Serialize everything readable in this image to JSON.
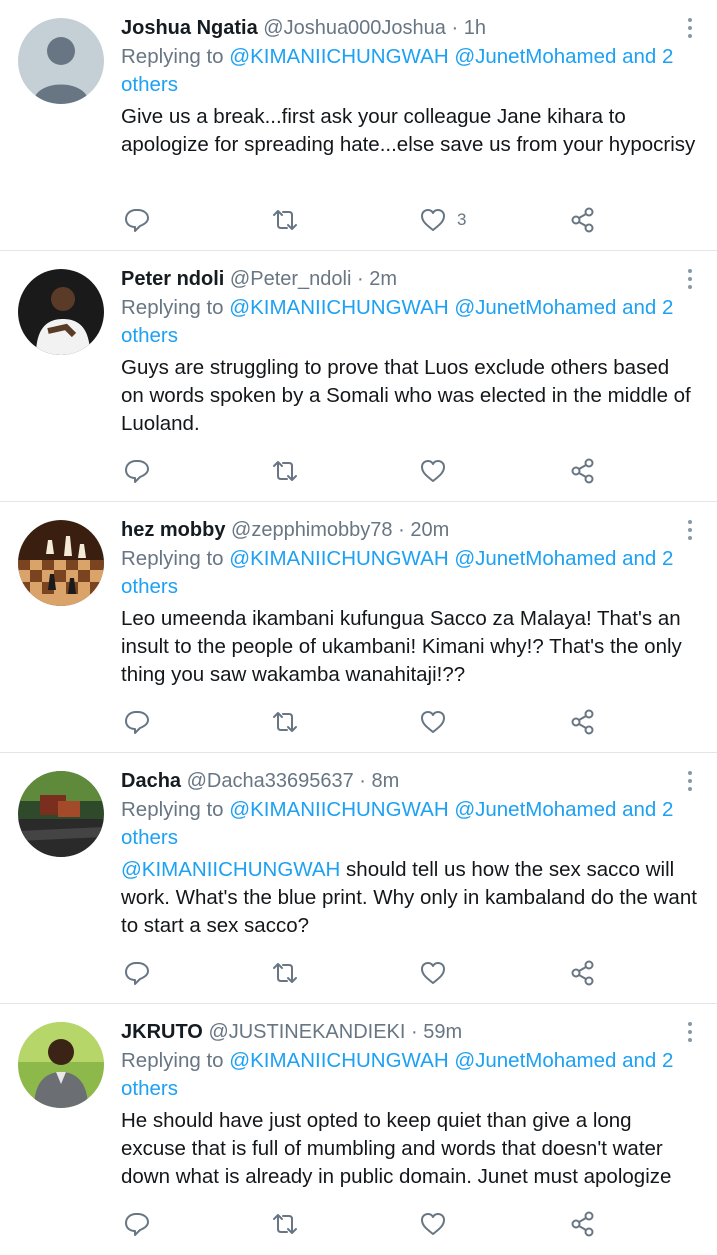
{
  "tweets": [
    {
      "name": "Joshua Ngatia",
      "handle": "@Joshua000Joshua",
      "time": "1h",
      "replying_label": "Replying to",
      "replying_to": "@KIMANIICHUNGWAH @JunetMohamed and 2 others",
      "mention": "",
      "text": "Give us a break...first ask your colleague Jane kihara to apologize for spreading hate...else save us from your hypocrisy",
      "like_count": "3",
      "avatar": "default-profile-icon"
    },
    {
      "name": "Peter ndoli",
      "handle": "@Peter_ndoli",
      "time": "2m",
      "replying_label": "Replying to",
      "replying_to": "@KIMANIICHUNGWAH @JunetMohamed and 2 others",
      "mention": "",
      "text": "Guys are struggling to prove that Luos exclude others based on words spoken by a Somali who was elected in the middle of Luoland.",
      "like_count": "",
      "avatar": "person-photo"
    },
    {
      "name": "hez mobby",
      "handle": "@zepphimobby78",
      "time": "20m",
      "replying_label": "Replying to",
      "replying_to": "@KIMANIICHUNGWAH @JunetMohamed and 2 others",
      "mention": "",
      "text": "Leo umeenda ikambani kufungua Sacco za Malaya! That's an insult to the people of ukambani! Kimani why!? That's the only thing you saw wakamba wanahitaji!??",
      "like_count": "",
      "avatar": "chess-board-photo"
    },
    {
      "name": "Dacha",
      "handle": "@Dacha33695637",
      "time": "8m",
      "replying_label": "Replying to",
      "replying_to": "@KIMANIICHUNGWAH @JunetMohamed and 2 others",
      "mention": "@KIMANIICHUNGWAH",
      "text": " should tell us how the sex sacco will work. What's the blue print. Why only in kambaland do the want to start a sex sacco?",
      "like_count": "",
      "avatar": "outdoor-photo"
    },
    {
      "name": "JKRUTO",
      "handle": "@JUSTINEKANDIEKI",
      "time": "59m",
      "replying_label": "Replying to",
      "replying_to": "@KIMANIICHUNGWAH @JunetMohamed and 2 others",
      "mention": "",
      "text": "He should have just opted to keep quiet than give a long excuse that is full of mumbling and words that doesn't water down what is already in public domain. Junet must apologize",
      "like_count": "",
      "avatar": "person-photo"
    }
  ],
  "colors": {
    "link": "#1da1f2",
    "muted": "#687684",
    "text": "#14171a",
    "divider": "#e2e6e9"
  }
}
